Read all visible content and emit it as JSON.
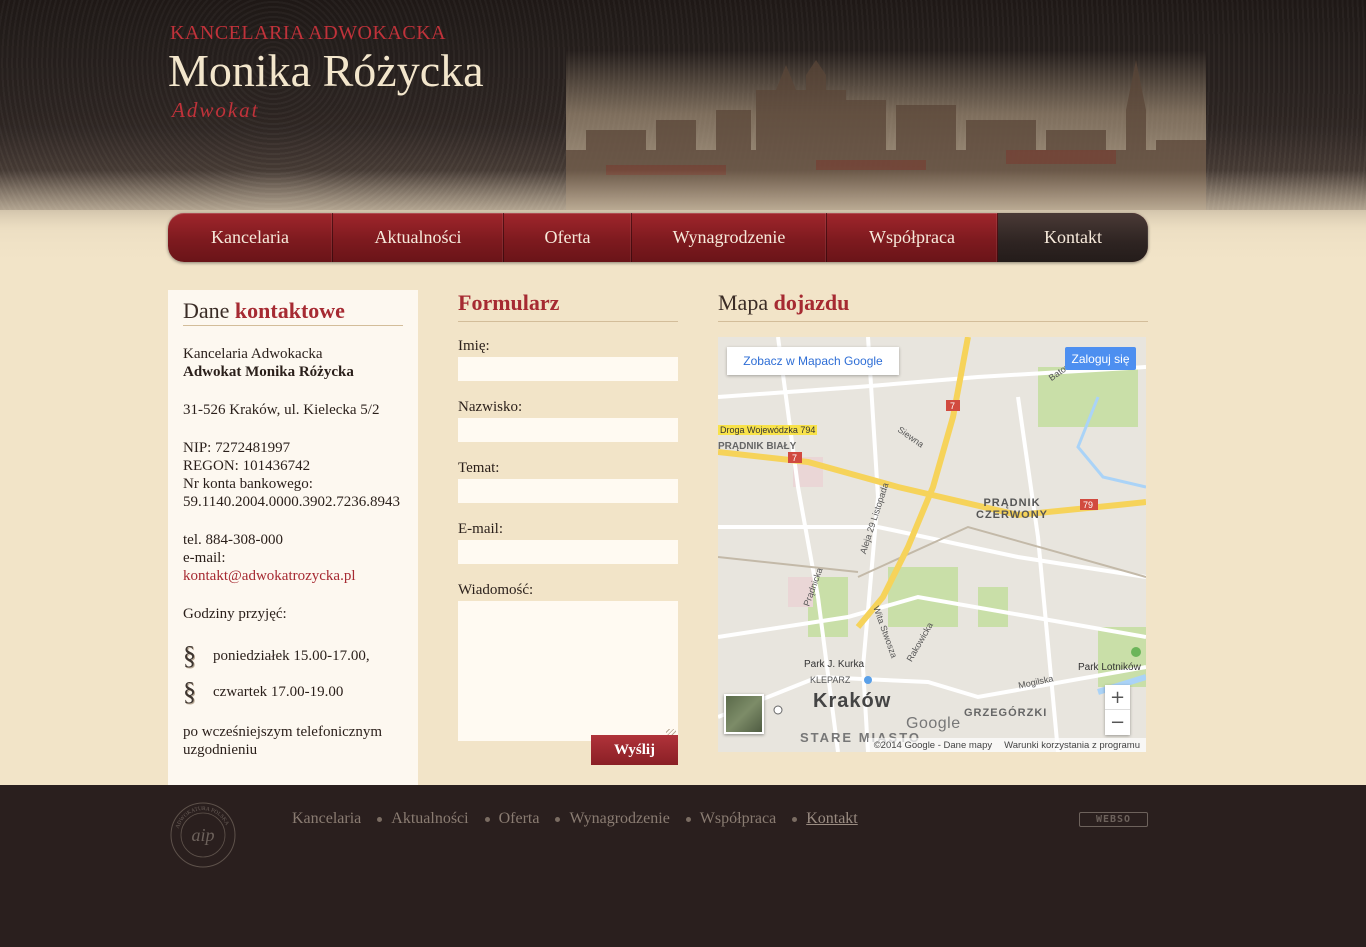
{
  "header": {
    "firm_label": "KANCELARIA ADWOKACKA",
    "name": "Monika Różycka",
    "subtitle": "Adwokat"
  },
  "nav": {
    "items": [
      {
        "label": "Kancelaria"
      },
      {
        "label": "Aktualności"
      },
      {
        "label": "Oferta"
      },
      {
        "label": "Wynagrodzenie"
      },
      {
        "label": "Współpraca"
      },
      {
        "label": "Kontakt",
        "active": true
      }
    ]
  },
  "contact": {
    "title_plain": "Dane",
    "title_em": "kontaktowe",
    "firm": "Kancelaria Adwokacka",
    "lawyer": "Adwokat Monika Różycka",
    "address": "31-526 Kraków, ul. Kielecka 5/2",
    "nip": "NIP: 7272481997",
    "regon": "REGON: 101436742",
    "account_label": "Nr konta bankowego:",
    "account_number": "59.1140.2004.0000.3902.7236.8943",
    "phone": "tel. 884-308-000",
    "email_label": "e-mail:",
    "email": "kontakt@adwokatrozycka.pl",
    "hours_label": "Godziny przyjęć:",
    "hours": [
      "poniedziałek 15.00-17.00,",
      "czwartek 17.00-19.00"
    ],
    "note": "po wcześniejszym telefonicznym uzgodnieniu",
    "bullet_glyph": "§"
  },
  "form": {
    "title": "Formularz",
    "fields": {
      "name": {
        "label": "Imię:",
        "value": ""
      },
      "surname": {
        "label": "Nazwisko:",
        "value": ""
      },
      "subject": {
        "label": "Temat:",
        "value": ""
      },
      "email": {
        "label": "E-mail:",
        "value": ""
      },
      "message": {
        "label": "Wiadomość:",
        "value": ""
      }
    },
    "submit_label": "Wyślij"
  },
  "map_section": {
    "title_plain": "Mapa",
    "title_em": "dojazdu",
    "open_in_maps": "Zobacz w Mapach Google",
    "sign_in": "Zaloguj się",
    "labels": {
      "road": "Droga Wojewódzka 794",
      "pradnik_bialy": "PRĄDNIK BIAŁY",
      "pradnik_czerwony": "PRĄDNIK CZERWONY",
      "krakow": "Kraków",
      "kleparz": "KLEPARZ",
      "stare_miasto": "STARE MIASTO",
      "grzegorzki": "GRZEGÓRZKI",
      "park_kurka": "Park J. Kurka",
      "park_lotnikow": "Park Lotników",
      "aleja_29": "Aleja 29 Listopada",
      "batowicka": "Batowicka",
      "siewna": "Siewna",
      "pradnicka": "Prądnicka",
      "rakowicka": "Rakowicka",
      "mogilska": "Mogilska",
      "wita_stwosza": "Wita Stwosza",
      "road_7": "7",
      "road_79": "79"
    },
    "attribution": "©2014 Google - Dane mapy",
    "terms": "Warunki korzystania z programu",
    "google_logo": "Google",
    "zoom_in": "+",
    "zoom_out": "−"
  },
  "footer": {
    "nav": [
      {
        "label": "Kancelaria"
      },
      {
        "label": "Aktualności"
      },
      {
        "label": "Oferta"
      },
      {
        "label": "Wynagrodzenie"
      },
      {
        "label": "Współpraca"
      },
      {
        "label": "Kontakt",
        "active": true
      }
    ],
    "badge": "WEBSO",
    "logo_text": "ADWOKATURA POLSKA"
  },
  "colors": {
    "accent": "#a62a32",
    "nav_red": "#7e1a1f",
    "nav_active": "#2e2422",
    "page_bg": "#f2e4c8",
    "footer_bg": "#2a1f1e"
  }
}
